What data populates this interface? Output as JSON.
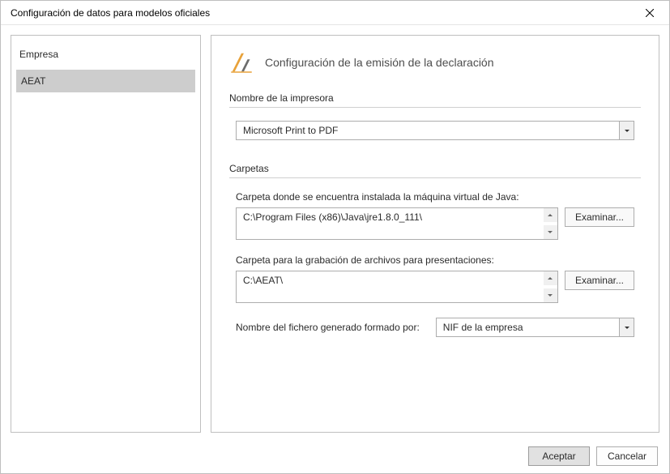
{
  "title": "Configuración de datos para modelos oficiales",
  "sidebar": {
    "header": "Empresa",
    "items": [
      "AEAT"
    ]
  },
  "main": {
    "heading": "Configuración de la emisión de la declaración",
    "printer": {
      "section_label": "Nombre de la impresora",
      "value": "Microsoft Print to PDF"
    },
    "folders": {
      "section_label": "Carpetas",
      "java": {
        "label": "Carpeta donde se encuentra instalada la máquina virtual de Java:",
        "value": "C:\\Program Files (x86)\\Java\\jre1.8.0_111\\",
        "browse": "Examinar..."
      },
      "record": {
        "label": "Carpeta para la grabación de archivos para presentaciones:",
        "value": "C:\\AEAT\\",
        "browse": "Examinar..."
      },
      "filename": {
        "label": "Nombre del fichero generado formado por:",
        "value": "NIF de la empresa"
      }
    }
  },
  "footer": {
    "accept": "Aceptar",
    "cancel": "Cancelar"
  }
}
